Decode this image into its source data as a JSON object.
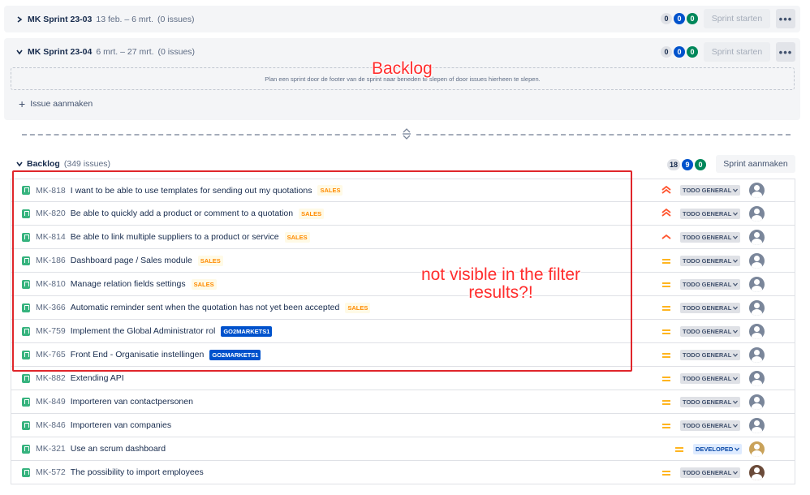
{
  "sprints": [
    {
      "name": "MK Sprint 23-03",
      "dates": "13 feb. – 6 mrt.",
      "count": "(0 issues)",
      "expanded": false,
      "counts": [
        "0",
        "0",
        "0"
      ],
      "start_label": "Sprint starten",
      "more_label": "•••"
    },
    {
      "name": "MK Sprint 23-04",
      "dates": "6 mrt. – 27 mrt.",
      "count": "(0 issues)",
      "expanded": true,
      "counts": [
        "0",
        "0",
        "0"
      ],
      "start_label": "Sprint starten",
      "more_label": "•••",
      "dropzone": "Plan een sprint door de footer van de sprint naar beneden te slepen of door issues hierheen te slepen.",
      "create_label": "Issue aanmaken"
    }
  ],
  "backlog": {
    "title": "Backlog",
    "count": "(349 issues)",
    "counts": [
      "18",
      "9",
      "0"
    ],
    "create_sprint_label": "Sprint aanmaken"
  },
  "issues": [
    {
      "key": "MK-818",
      "summary": "I want to be able to use templates for sending out my quotations",
      "epic": "SALES",
      "epic_type": "sales",
      "priority": "highest",
      "status": "TODO GENERAL",
      "avatar": "default"
    },
    {
      "key": "MK-820",
      "summary": "Be able to quickly add a product or comment to a quotation",
      "epic": "SALES",
      "epic_type": "sales",
      "priority": "highest",
      "status": "TODO GENERAL",
      "avatar": "default"
    },
    {
      "key": "MK-814",
      "summary": "Be able to link multiple suppliers to a product or service",
      "epic": "SALES",
      "epic_type": "sales",
      "priority": "high",
      "status": "TODO GENERAL",
      "avatar": "default"
    },
    {
      "key": "MK-186",
      "summary": "Dashboard page / Sales module",
      "epic": "SALES",
      "epic_type": "sales",
      "priority": "medium",
      "status": "TODO GENERAL",
      "avatar": "default"
    },
    {
      "key": "MK-810",
      "summary": "Manage relation fields settings",
      "epic": "SALES",
      "epic_type": "sales",
      "priority": "medium",
      "status": "TODO GENERAL",
      "avatar": "default"
    },
    {
      "key": "MK-366",
      "summary": "Automatic reminder sent when the quotation has not yet been accepted",
      "epic": "SALES",
      "epic_type": "sales",
      "priority": "medium",
      "status": "TODO GENERAL",
      "avatar": "default"
    },
    {
      "key": "MK-759",
      "summary": "Implement the Global Administrator rol",
      "epic": "GO2MARKETS1",
      "epic_type": "go2",
      "priority": "medium",
      "status": "TODO GENERAL",
      "avatar": "default"
    },
    {
      "key": "MK-765",
      "summary": "Front End - Organisatie instellingen",
      "epic": "GO2MARKETS1",
      "epic_type": "go2",
      "priority": "medium",
      "status": "TODO GENERAL",
      "avatar": "default"
    },
    {
      "key": "MK-882",
      "summary": "Extending API",
      "epic": "",
      "epic_type": "",
      "priority": "medium",
      "status": "TODO GENERAL",
      "avatar": "default"
    },
    {
      "key": "MK-849",
      "summary": "Importeren van contactpersonen",
      "epic": "",
      "epic_type": "",
      "priority": "medium",
      "status": "TODO GENERAL",
      "avatar": "default"
    },
    {
      "key": "MK-846",
      "summary": "Importeren van companies",
      "epic": "",
      "epic_type": "",
      "priority": "medium",
      "status": "TODO GENERAL",
      "avatar": "default"
    },
    {
      "key": "MK-321",
      "summary": "Use an scrum dashboard",
      "epic": "",
      "epic_type": "",
      "priority": "medium",
      "status": "DEVELOPED",
      "avatar": "photo1"
    },
    {
      "key": "MK-572",
      "summary": "The possibility to import employees",
      "epic": "",
      "epic_type": "",
      "priority": "medium",
      "status": "TODO GENERAL",
      "avatar": "photo2"
    }
  ],
  "annotations": {
    "backlog_label": "Backlog",
    "filter_note": "not visible in the filter results?!"
  },
  "icons": {
    "story": "story-icon",
    "chevron": "chevron-icon",
    "plus": "plus-icon",
    "more": "more-icon",
    "drag": "drag-handle-icon"
  },
  "colors": {
    "sales_epic": "#ff8b00",
    "go2_epic": "#0052cc",
    "annotation_red": "#ff2d2d",
    "priority_high": "#ff5630",
    "priority_medium": "#ffab00"
  }
}
